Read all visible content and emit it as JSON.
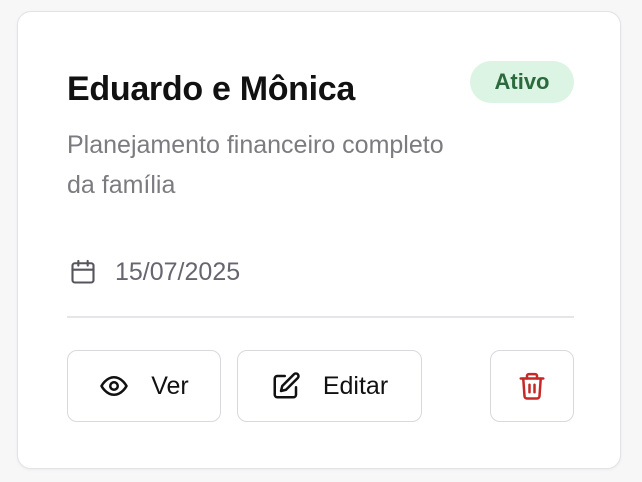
{
  "card": {
    "title": "Eduardo e Mônica",
    "status": "Ativo",
    "description": "Planejamento financeiro completo da família",
    "date": "15/07/2025"
  },
  "actions": {
    "view_label": "Ver",
    "edit_label": "Editar"
  },
  "icons": {
    "date": "calendar-icon",
    "view": "eye-icon",
    "edit": "pencil-square-icon",
    "delete": "trash-icon"
  },
  "colors": {
    "status_bg": "#dcf4e3",
    "status_text": "#2b6a3d",
    "delete_icon": "#c62828"
  }
}
